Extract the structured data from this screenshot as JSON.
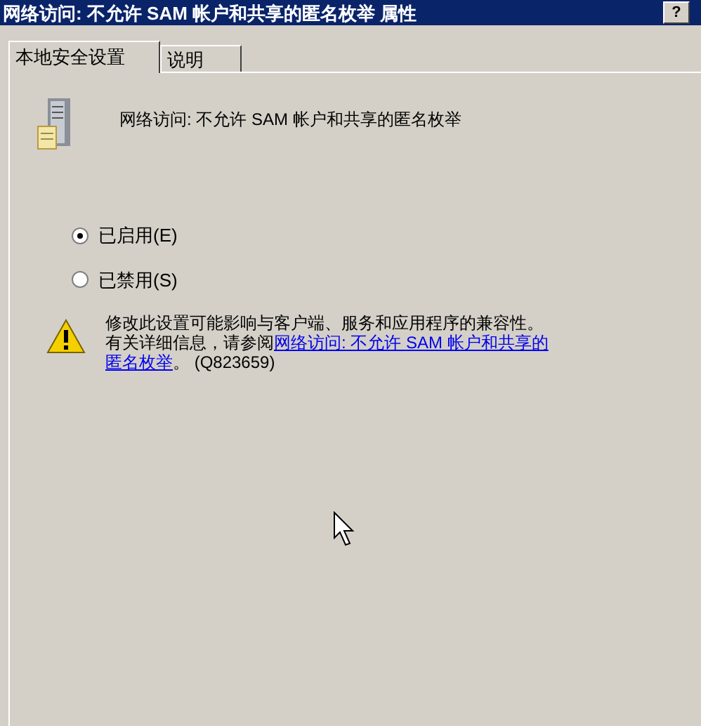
{
  "window": {
    "title": "网络访问: 不允许 SAM 帐户和共享的匿名枚举 属性",
    "help_button": "?"
  },
  "tabs": [
    {
      "label": "本地安全设置",
      "selected": true
    },
    {
      "label": "说明",
      "selected": false
    }
  ],
  "policy_name": "网络访问: 不允许 SAM 帐户和共享的匿名枚举",
  "options": [
    {
      "label": "已启用(E)",
      "selected": true
    },
    {
      "label": "已禁用(S)",
      "selected": false
    }
  ],
  "warning": {
    "text": "修改此设置可能影响与客户端、服务和应用程序的兼容性。",
    "more": "有关详细信息，请参阅",
    "link_lines": [
      "网络访问: 不允许 SAM 帐户和共享的",
      "匿名枚举"
    ],
    "suffix": "。 (Q823659)"
  }
}
